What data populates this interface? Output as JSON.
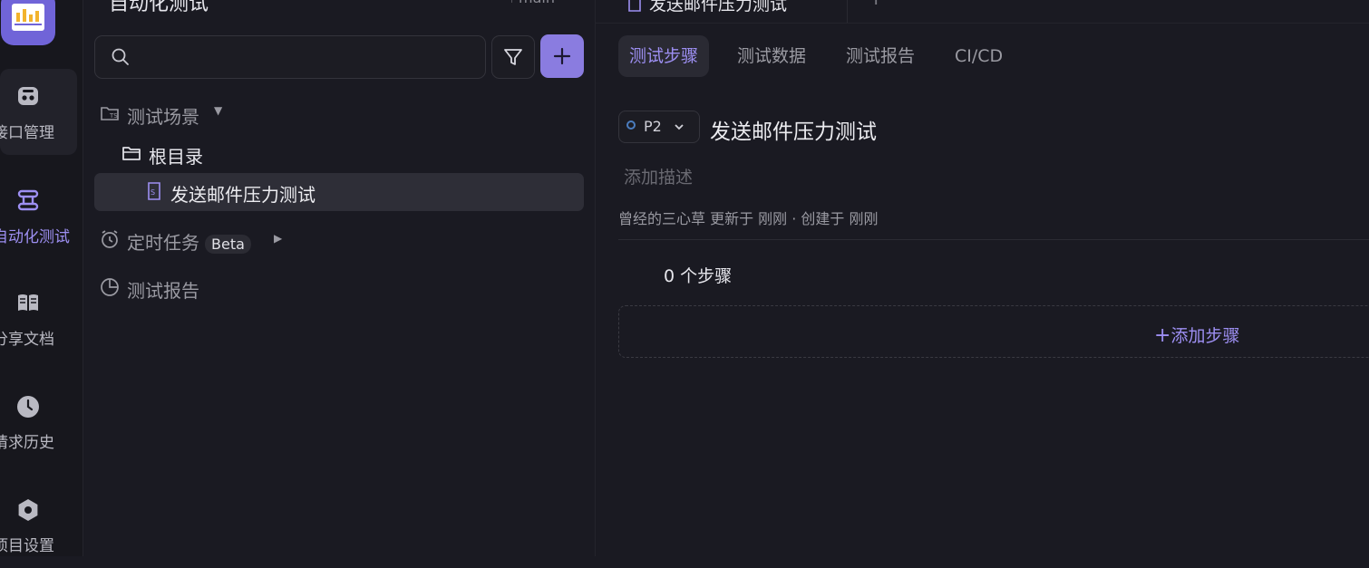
{
  "rail": {
    "items": [
      {
        "label": "接口管理"
      },
      {
        "label": "自动化测试"
      },
      {
        "label": "分享文档"
      },
      {
        "label": "请求历史"
      },
      {
        "label": "项目设置"
      }
    ]
  },
  "tree": {
    "title": "自动化测试",
    "branch": "main",
    "search_placeholder": "",
    "section_scenarios": "测试场景",
    "root_folder": "根目录",
    "selected_case": "发送邮件压力测试",
    "scheduled": "定时任务",
    "beta_badge": "Beta",
    "reports": "测试报告"
  },
  "main": {
    "open_tab": "发送邮件压力测试",
    "tab_plus": "+",
    "subtabs": [
      "测试步骤",
      "测试数据",
      "测试报告",
      "CI/CD"
    ],
    "priority": "P2",
    "case_title": "发送邮件压力测试",
    "description_placeholder": "添加描述",
    "meta": "曾经的三心草 更新于 刚刚 · 创建于 刚刚",
    "steps_count": "0 个步骤",
    "add_step": "添加步骤"
  },
  "colors": {
    "accent": "#8a7ce0",
    "accent_text": "#9d8ff2",
    "background": "#1a1a22"
  }
}
